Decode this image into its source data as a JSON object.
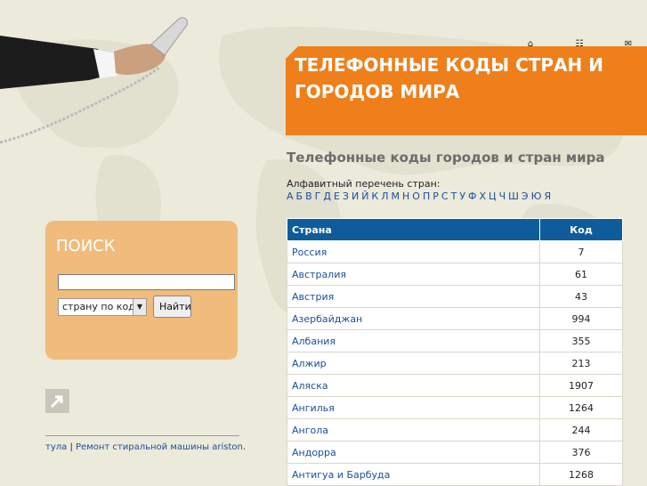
{
  "banner": {
    "title": "Телефонные коды стран и городов мира",
    "color": "#ef7f1a"
  },
  "top_icons": [
    "home-icon",
    "sitemap-icon",
    "mail-icon"
  ],
  "subtitle": "Телефонные коды городов и стран мира",
  "alphabet": {
    "label": "Алфавитный перечень стран:",
    "letters": [
      "А",
      "Б",
      "В",
      "Г",
      "Д",
      "Е",
      "З",
      "И",
      "Й",
      "К",
      "Л",
      "М",
      "Н",
      "О",
      "П",
      "Р",
      "С",
      "Т",
      "У",
      "Ф",
      "Х",
      "Ц",
      "Ч",
      "Ш",
      "Э",
      "Ю",
      "Я"
    ]
  },
  "table": {
    "headers": {
      "country": "Страна",
      "code": "Код"
    },
    "header_color": "#0e5c9c",
    "rows": [
      {
        "country": "Россия",
        "code": "7"
      },
      {
        "country": "Австралия",
        "code": "61"
      },
      {
        "country": "Австрия",
        "code": "43"
      },
      {
        "country": "Азербайджан",
        "code": "994"
      },
      {
        "country": "Албания",
        "code": "355"
      },
      {
        "country": "Алжир",
        "code": "213"
      },
      {
        "country": "Аляска",
        "code": "1907"
      },
      {
        "country": "Ангилья",
        "code": "1264"
      },
      {
        "country": "Ангола",
        "code": "244"
      },
      {
        "country": "Андорра",
        "code": "376"
      },
      {
        "country": "Антигуа и Барбуда",
        "code": "1268"
      }
    ]
  },
  "search": {
    "title": "ПОИСК",
    "input_value": "",
    "select_value": "страну по коду",
    "button_label": "Найти",
    "box_color": "#f0bb7b"
  },
  "footer": {
    "link1": "тула",
    "separator": "|",
    "link2": "Ремонт стиральной машины ariston",
    "suffix": "."
  }
}
